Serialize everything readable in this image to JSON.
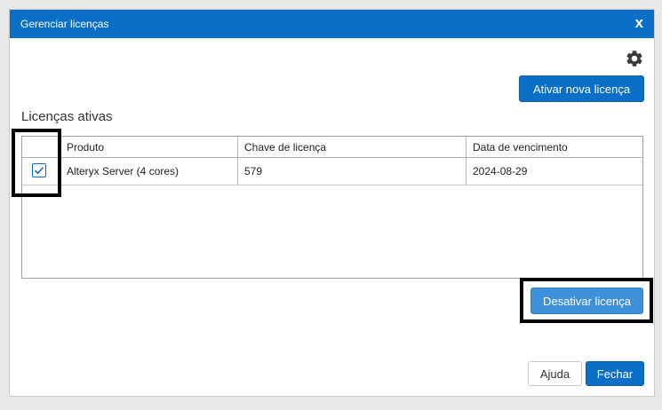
{
  "dialog": {
    "title": "Gerenciar licenças",
    "close_label": "x"
  },
  "toolbar": {
    "settings_icon": "gear-icon",
    "activate_label": "Ativar nova licença"
  },
  "licenses": {
    "section_title": "Licenças ativas",
    "columns": [
      "Produto",
      "Chave de licença",
      "Data de vencimento"
    ],
    "rows": [
      {
        "checked": true,
        "product": "Alteryx Server (4 cores)",
        "key": "579",
        "expiry": "2024-08-29"
      }
    ]
  },
  "actions": {
    "deactivate_label": "Desativar licença",
    "help_label": "Ajuda",
    "close_label": "Fechar"
  },
  "colors": {
    "accent": "#0b6fc7",
    "deactivate": "#3d91db",
    "highlight": "#000000"
  }
}
